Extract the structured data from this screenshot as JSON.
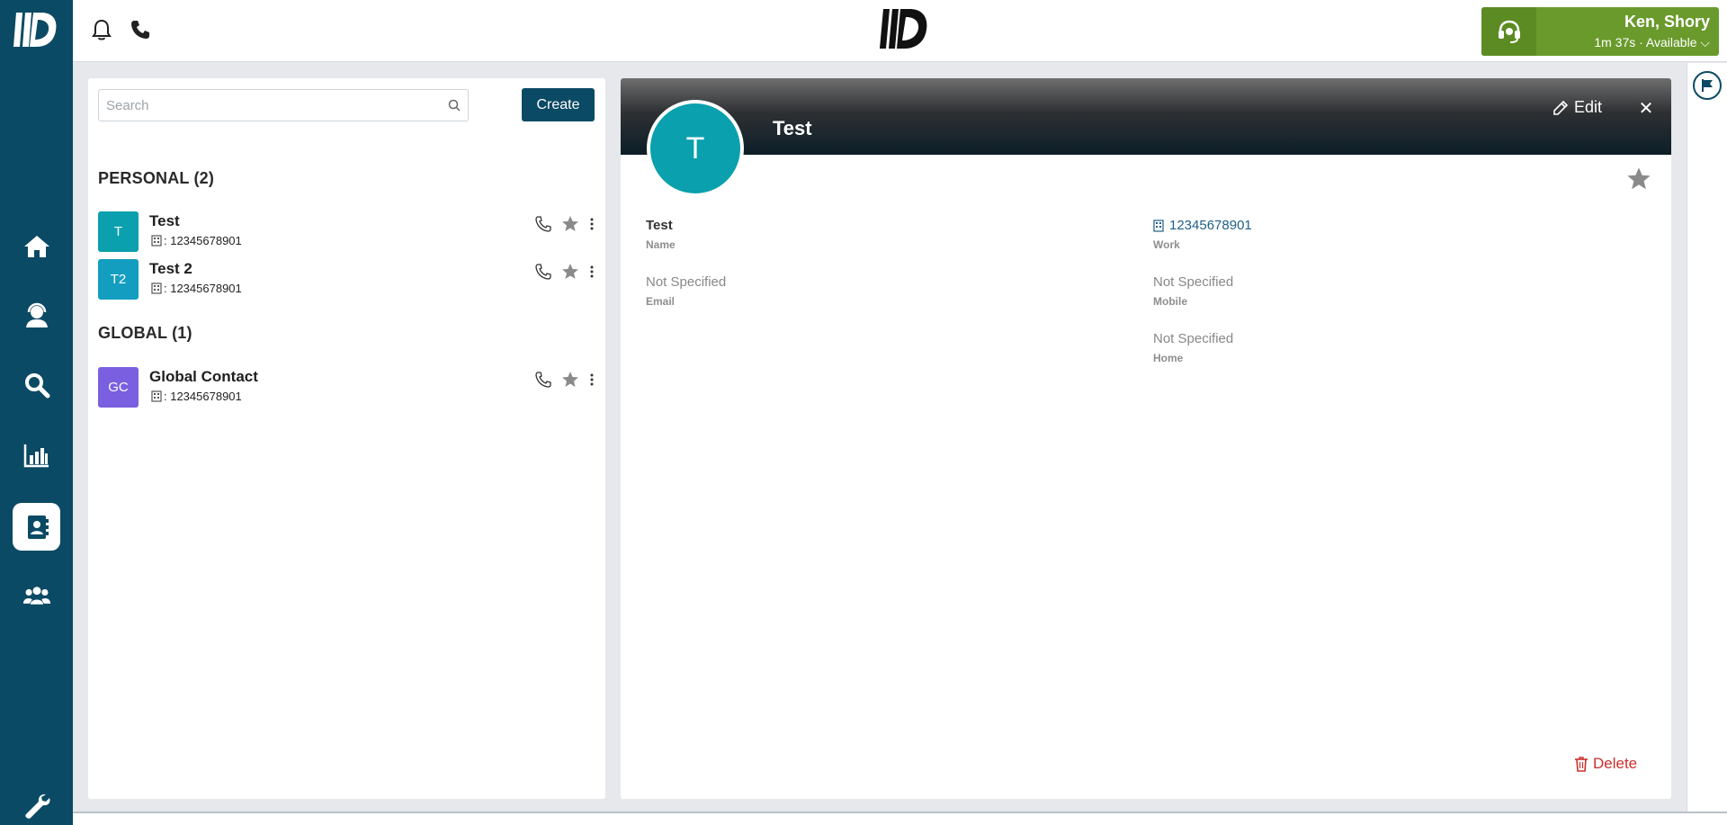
{
  "app": {
    "name": "ID Contact Center",
    "colors": {
      "nav_bg": "#0b4a64",
      "status_green": "#6a9a2c",
      "accent_teal": "#0aa0ad",
      "delete_red": "#c9302c"
    }
  },
  "sidebar": {
    "items": [
      {
        "name": "home",
        "icon": "home-icon"
      },
      {
        "name": "agent",
        "icon": "agent-icon"
      },
      {
        "name": "search",
        "icon": "search-icon"
      },
      {
        "name": "reports",
        "icon": "chart-icon"
      },
      {
        "name": "contacts",
        "icon": "address-book-icon",
        "active": true
      },
      {
        "name": "team",
        "icon": "users-icon"
      },
      {
        "name": "settings",
        "icon": "wrench-icon"
      }
    ]
  },
  "topbar": {
    "user": {
      "name": "Ken, Shory",
      "status": "1m 37s · Available"
    }
  },
  "contacts": {
    "search_placeholder": "Search",
    "create_label": "Create",
    "personal": {
      "title": "PERSONAL (2)",
      "items": [
        {
          "initials": "T",
          "name": "Test",
          "number": ": 12345678901",
          "color": "#0aa0ad"
        },
        {
          "initials": "T2",
          "name": "Test 2",
          "number": ": 12345678901",
          "color": "#139ec0"
        }
      ]
    },
    "global": {
      "title": "GLOBAL (1)",
      "items": [
        {
          "initials": "GC",
          "name": "Global Contact",
          "number": ": 12345678901",
          "color": "#7a5fe0"
        }
      ]
    }
  },
  "detail": {
    "initial": "T",
    "name": "Test",
    "edit_label": "Edit",
    "close_label": "✕",
    "fields": {
      "name_value": "Test",
      "name_label": "Name",
      "email_value": "Not Specified",
      "email_label": "Email",
      "work_value": "12345678901",
      "work_label": "Work",
      "mobile_value": "Not Specified",
      "mobile_label": "Mobile",
      "home_value": "Not Specified",
      "home_label": "Home"
    },
    "delete_label": "Delete"
  }
}
